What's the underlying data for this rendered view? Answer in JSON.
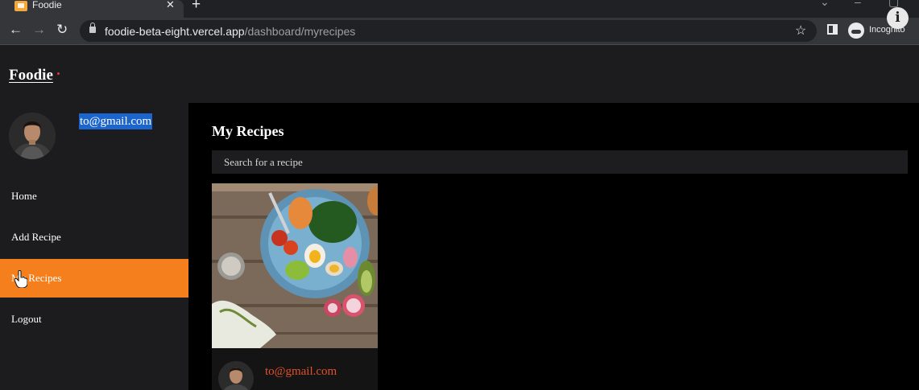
{
  "browser": {
    "tab_title": "Foodie",
    "url_host": "foodie-beta-eight.vercel.app",
    "url_path": "/dashboard/myrecipes",
    "incognito_label": "Incognito"
  },
  "app": {
    "logo": "Foodie",
    "user_email": "to@gmail.com",
    "nav": [
      {
        "label": "Home",
        "active": false
      },
      {
        "label": "Add Recipe",
        "active": false
      },
      {
        "label": "My Recipes",
        "active": true
      },
      {
        "label": "Logout",
        "active": false
      }
    ],
    "page_title": "My Recipes",
    "search_placeholder": "Search for a recipe",
    "recipes": [
      {
        "author_email": "to@gmail.com"
      }
    ]
  },
  "colors": {
    "accent": "#f57f1c",
    "author_link": "#e3502b",
    "selection": "#1c65cc"
  }
}
